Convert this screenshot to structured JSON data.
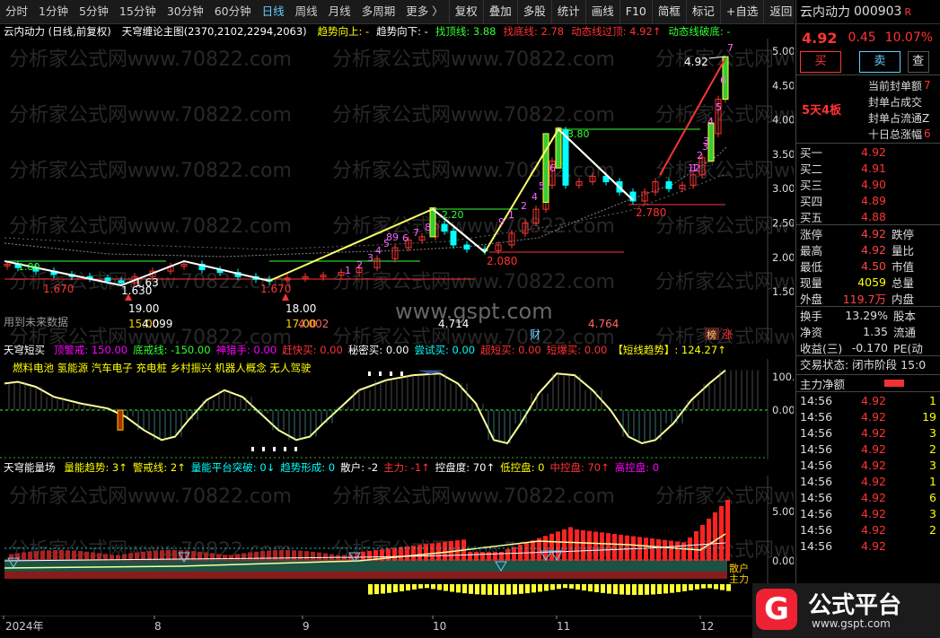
{
  "toolbar": {
    "periods": [
      "分时",
      "1分钟",
      "5分钟",
      "15分钟",
      "30分钟",
      "60分钟",
      "日线",
      "周线",
      "月线",
      "多周期",
      "更多 〉"
    ],
    "active_period": "日线",
    "tools": [
      "复权",
      "叠加",
      "多股",
      "统计",
      "画线",
      "F10",
      "简框",
      "标记",
      "+自选",
      "返回"
    ]
  },
  "main_panel": {
    "title": "云内动力 (日线,前复权)",
    "indicator_title": "天穹缠论主图(2370,2102,2294,2063)",
    "legend": [
      {
        "text": "趋势向上: -",
        "color": "#ffff00"
      },
      {
        "text": "趋势向下: -",
        "color": "#ffffff"
      },
      {
        "text": "找顶线: 3.88",
        "color": "#33ff33"
      },
      {
        "text": "找底线: 2.78",
        "color": "#ff3333"
      },
      {
        "text": "动态线过顶: 4.92↑",
        "color": "#ff3333"
      },
      {
        "text": "动态线破底: -",
        "color": "#33ff33"
      }
    ],
    "y_ticks": [
      "5.00",
      "4.50",
      "4.00",
      "3.50",
      "3.00",
      "2.50",
      "2.00",
      "1.50"
    ],
    "watermark": "分析家公式网www.70822.com",
    "site_watermark": "www.gspt.com",
    "note": "用到未来数据",
    "annotations": {
      "high_label": "4.92",
      "price_labels": [
        "1.670",
        "1.630",
        "1.63",
        "1.670",
        "2.080",
        "2.780"
      ],
      "num_labels": [
        "19.00",
        "18.00",
        "4.714",
        "4.764"
      ],
      "sub_labels": [
        "15.00",
        "4.099",
        "17.00",
        "4.002"
      ],
      "tag_cai": "财",
      "tag_bang": "榜",
      "tag_zhang": "涨",
      "wave_numbers": [
        "7",
        "6",
        "5",
        "4",
        "3",
        "2",
        "1",
        "89",
        "1",
        "2",
        "3",
        "4",
        "5",
        "6",
        "7",
        "8",
        "9",
        "1",
        "2",
        "4",
        "5",
        "6",
        "12",
        "3"
      ],
      "label_220": "2.20",
      "label_380": "3.80",
      "label_180": "1.80"
    }
  },
  "mid_panel": {
    "title": "天穹短买",
    "legend": [
      {
        "text": "顶警戒: 150.00",
        "color": "#ff00ff"
      },
      {
        "text": "底戒线: -150.00",
        "color": "#33ff33"
      },
      {
        "text": "神猎手: 0.00",
        "color": "#ff00ff"
      },
      {
        "text": "赶快买: 0.00",
        "color": "#ff3333"
      },
      {
        "text": "秘密买: 0.00",
        "color": "#ffffff"
      },
      {
        "text": "尝试买: 0.00",
        "color": "#00ffff"
      },
      {
        "text": "超短买: 0.00",
        "color": "#ff3333"
      },
      {
        "text": "短爆买: 0.00",
        "color": "#ff3333"
      },
      {
        "text": "【短线趋势】: 124.27↑",
        "color": "#ffff00"
      }
    ],
    "concepts": "燃料电池 氢能源 汽车电子 充电桩 乡村振兴 机器人概念 无人驾驶",
    "y_ticks": [
      "100.0",
      "0.00"
    ]
  },
  "bottom_panel": {
    "title": "天穹能量场",
    "legend": [
      {
        "text": "量能趋势: 3↑",
        "color": "#ffff00"
      },
      {
        "text": "警戒线: 2↑",
        "color": "#ffff00"
      },
      {
        "text": "量能平台突破: 0↓",
        "color": "#00ffff"
      },
      {
        "text": "趋势形成: 0",
        "color": "#00ffff"
      },
      {
        "text": "散户: -2",
        "color": "#ffffff"
      },
      {
        "text": "主力: -1↑",
        "color": "#ff3333"
      },
      {
        "text": "控盘度: 70↑",
        "color": "#ffffff"
      },
      {
        "text": "低控盘: 0",
        "color": "#ffff00"
      },
      {
        "text": "中控盘: 70↑",
        "color": "#ff3333"
      },
      {
        "text": "高控盘: 0",
        "color": "#ff00ff"
      }
    ],
    "y_ticks": [
      "5.00",
      "0.00"
    ],
    "side_labels": [
      "散户",
      "主力"
    ]
  },
  "x_axis": {
    "labels": [
      "2024年",
      "8",
      "9",
      "10",
      "11",
      "12"
    ]
  },
  "right_panel": {
    "stock_name": "云内动力",
    "code": "000903",
    "r_flag": "R",
    "price": "4.92",
    "change": "0.45",
    "pct": "10.07%",
    "buy_label": "买",
    "sell_label": "卖",
    "more_label": "查",
    "limit_label": "5天4板",
    "seal_rows": [
      {
        "k": "当前封单额",
        "v": "7"
      },
      {
        "k": "封单占成交",
        "v": ""
      },
      {
        "k": "封单占流通Z",
        "v": ""
      },
      {
        "k": "十日总涨幅",
        "v": "6"
      }
    ],
    "bids": [
      {
        "k": "买一",
        "v": "4.92"
      },
      {
        "k": "买二",
        "v": "4.91"
      },
      {
        "k": "买三",
        "v": "4.90"
      },
      {
        "k": "买四",
        "v": "4.89"
      },
      {
        "k": "买五",
        "v": "4.88"
      }
    ],
    "stats": [
      {
        "k": "涨停",
        "v": "4.92",
        "k2": "跌停",
        "color": "#ff4444"
      },
      {
        "k": "最高",
        "v": "4.92",
        "k2": "量比",
        "color": "#ff4444"
      },
      {
        "k": "最低",
        "v": "4.50",
        "k2": "市值",
        "color": "#ff4444"
      },
      {
        "k": "现量",
        "v": "4059",
        "k2": "总量",
        "color": "#ffff00"
      },
      {
        "k": "外盘",
        "v": "119.7万",
        "k2": "内盘",
        "color": "#ff4444"
      }
    ],
    "stats2": [
      {
        "k": "换手",
        "v": "13.29%",
        "k2": "股本"
      },
      {
        "k": "净资",
        "v": "1.35",
        "k2": "流通"
      },
      {
        "k": "收益(三)",
        "v": "-0.170",
        "k2": "PE(动"
      }
    ],
    "trade_status": "交易状态: 闭市阶段 15:0",
    "net_label": "主力净额",
    "ticks": [
      {
        "t": "14:56",
        "p": "4.92",
        "v": "1"
      },
      {
        "t": "14:56",
        "p": "4.92",
        "v": "19"
      },
      {
        "t": "14:56",
        "p": "4.92",
        "v": "3"
      },
      {
        "t": "14:56",
        "p": "4.92",
        "v": "2"
      },
      {
        "t": "14:56",
        "p": "4.92",
        "v": "3"
      },
      {
        "t": "14:56",
        "p": "4.92",
        "v": "1"
      },
      {
        "t": "14:56",
        "p": "4.92",
        "v": "6"
      },
      {
        "t": "14:56",
        "p": "4.92",
        "v": "3"
      },
      {
        "t": "14:56",
        "p": "4.92",
        "v": "2"
      },
      {
        "t": "14:56",
        "p": "4.92",
        "v": ""
      }
    ]
  },
  "logo": {
    "text": "公式平台",
    "url": "www.gspt.com"
  },
  "colors": {
    "up": "#ff3333",
    "down": "#00ffff",
    "yellow": "#ffff00",
    "green": "#33ff33"
  }
}
